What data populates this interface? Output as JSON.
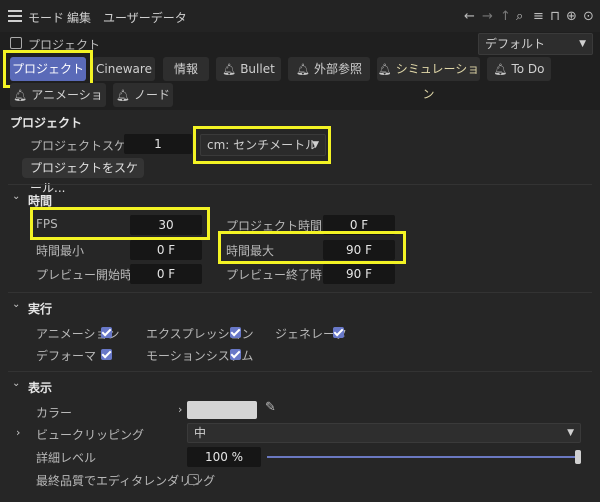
{
  "menubar": {
    "items": [
      {
        "label": "モード"
      },
      {
        "label": "編集"
      },
      {
        "label": "ユーザーデータ"
      }
    ],
    "icons": [
      "back-icon",
      "forward-icon",
      "up-icon",
      "search-icon",
      "filter-icon",
      "lock-icon",
      "new-icon",
      "settings-icon"
    ]
  },
  "titlebar": {
    "title": "プロジェクト",
    "dropdown": "デフォルト"
  },
  "tabs": [
    {
      "label": "プロジェクト"
    },
    {
      "label": "Cineware"
    },
    {
      "label": "情報"
    },
    {
      "label": "Bullet"
    },
    {
      "label": "外部参照"
    },
    {
      "label": "シミュレーション"
    },
    {
      "label": "To Do"
    },
    {
      "label": "アニメーション"
    },
    {
      "label": "ノード"
    }
  ],
  "project": {
    "heading": "プロジェクト",
    "scale_label": "プロジェクトスケール",
    "scale_value": "1",
    "unit": "cm: センチメートル",
    "scale_button": "プロジェクトをスケール..."
  },
  "time": {
    "heading": "時間",
    "fps_label": "FPS",
    "fps_value": "30",
    "project_time_label": "プロジェクト時間",
    "project_time_value": "0 F",
    "min_label": "時間最小",
    "min_value": "0 F",
    "max_label": "時間最大",
    "max_value": "90 F",
    "preview_start_label": "プレビュー開始時間",
    "preview_start_value": "0 F",
    "preview_end_label": "プレビュー終了時間",
    "preview_end_value": "90 F"
  },
  "exec": {
    "heading": "実行",
    "animation": "アニメーション",
    "expression": "エクスプレッション",
    "generator": "ジェネレータ",
    "deformer": "デフォーマ",
    "motion": "モーションシステム"
  },
  "display": {
    "heading": "表示",
    "color_label": "カラー",
    "color_value": "#d4d4d4",
    "clip_label": "ビュークリッピング",
    "clip_value": "中",
    "detail_label": "詳細レベル",
    "detail_value": "100 %",
    "detail_level": 1.0,
    "final_label": "最終品質でエディタレンダリング"
  },
  "colors": {
    "accent": "#5a6ab8",
    "highlight": "#f3f324"
  }
}
